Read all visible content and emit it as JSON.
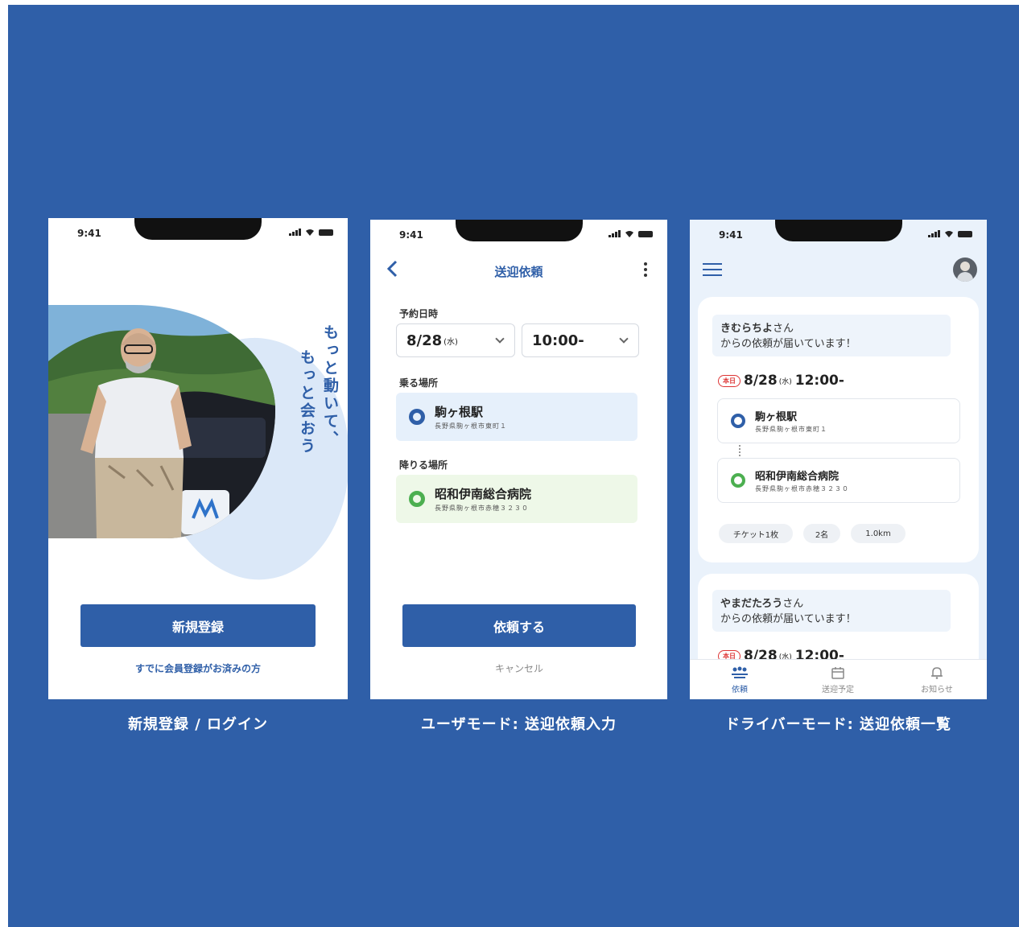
{
  "colors": {
    "brand_blue": "#2f5fa8",
    "green": "#4caf50",
    "pickup_bg": "#e6f0fb",
    "dropoff_bg": "#eef8e8",
    "today_red": "#d33333"
  },
  "phone1": {
    "status_time": "9:41",
    "tagline_line1": "もっと動いて、",
    "tagline_line2": "もっと会おう",
    "register_button": "新規登録",
    "login_link": "すでに会員登録がお済みの方",
    "caption": "新規登録 / ログイン"
  },
  "phone2": {
    "status_time": "9:41",
    "title": "送迎依頼",
    "back_icon": "chevron-left-icon",
    "menu_icon": "more-vertical-icon",
    "datetime_label": "予約日時",
    "date_value": "8/28",
    "date_weekday": "(水)",
    "time_value": "10:00-",
    "pickup_label": "乗る場所",
    "pickup_name": "駒ヶ根駅",
    "pickup_address": "長野県駒ヶ根市東町１",
    "dropoff_label": "降りる場所",
    "dropoff_name": "昭和伊南総合病院",
    "dropoff_address": "長野県駒ヶ根市赤穂３２３０",
    "submit_button": "依頼する",
    "cancel_link": "キャンセル",
    "caption": "ユーザモード: 送迎依頼入力"
  },
  "phone3": {
    "status_time": "9:41",
    "menu_icon": "hamburger-icon",
    "request1": {
      "name": "きむらちよ",
      "suffix": "さん",
      "message": "からの依頼が届いています！",
      "today_badge": "本日",
      "date": "8/28",
      "weekday": "(水)",
      "time": "12:00-",
      "pickup_name": "駒ヶ根駅",
      "pickup_address": "長野県駒ヶ根市東町１",
      "dropoff_name": "昭和伊南総合病院",
      "dropoff_address": "長野県駒ヶ根市赤穂３２３０",
      "chips": [
        "チケット1枚",
        "2名",
        "1.0km"
      ]
    },
    "request2": {
      "name": "やまだたろう",
      "suffix": "さん",
      "message": "からの依頼が届いています！",
      "today_badge": "本日",
      "date": "8/28",
      "weekday": "(水)",
      "time": "12:00-"
    },
    "tabs": [
      {
        "label": "依頼",
        "icon": "people-icon"
      },
      {
        "label": "送迎予定",
        "icon": "calendar-icon"
      },
      {
        "label": "お知らせ",
        "icon": "bell-icon"
      }
    ],
    "caption": "ドライバーモード: 送迎依頼一覧"
  }
}
